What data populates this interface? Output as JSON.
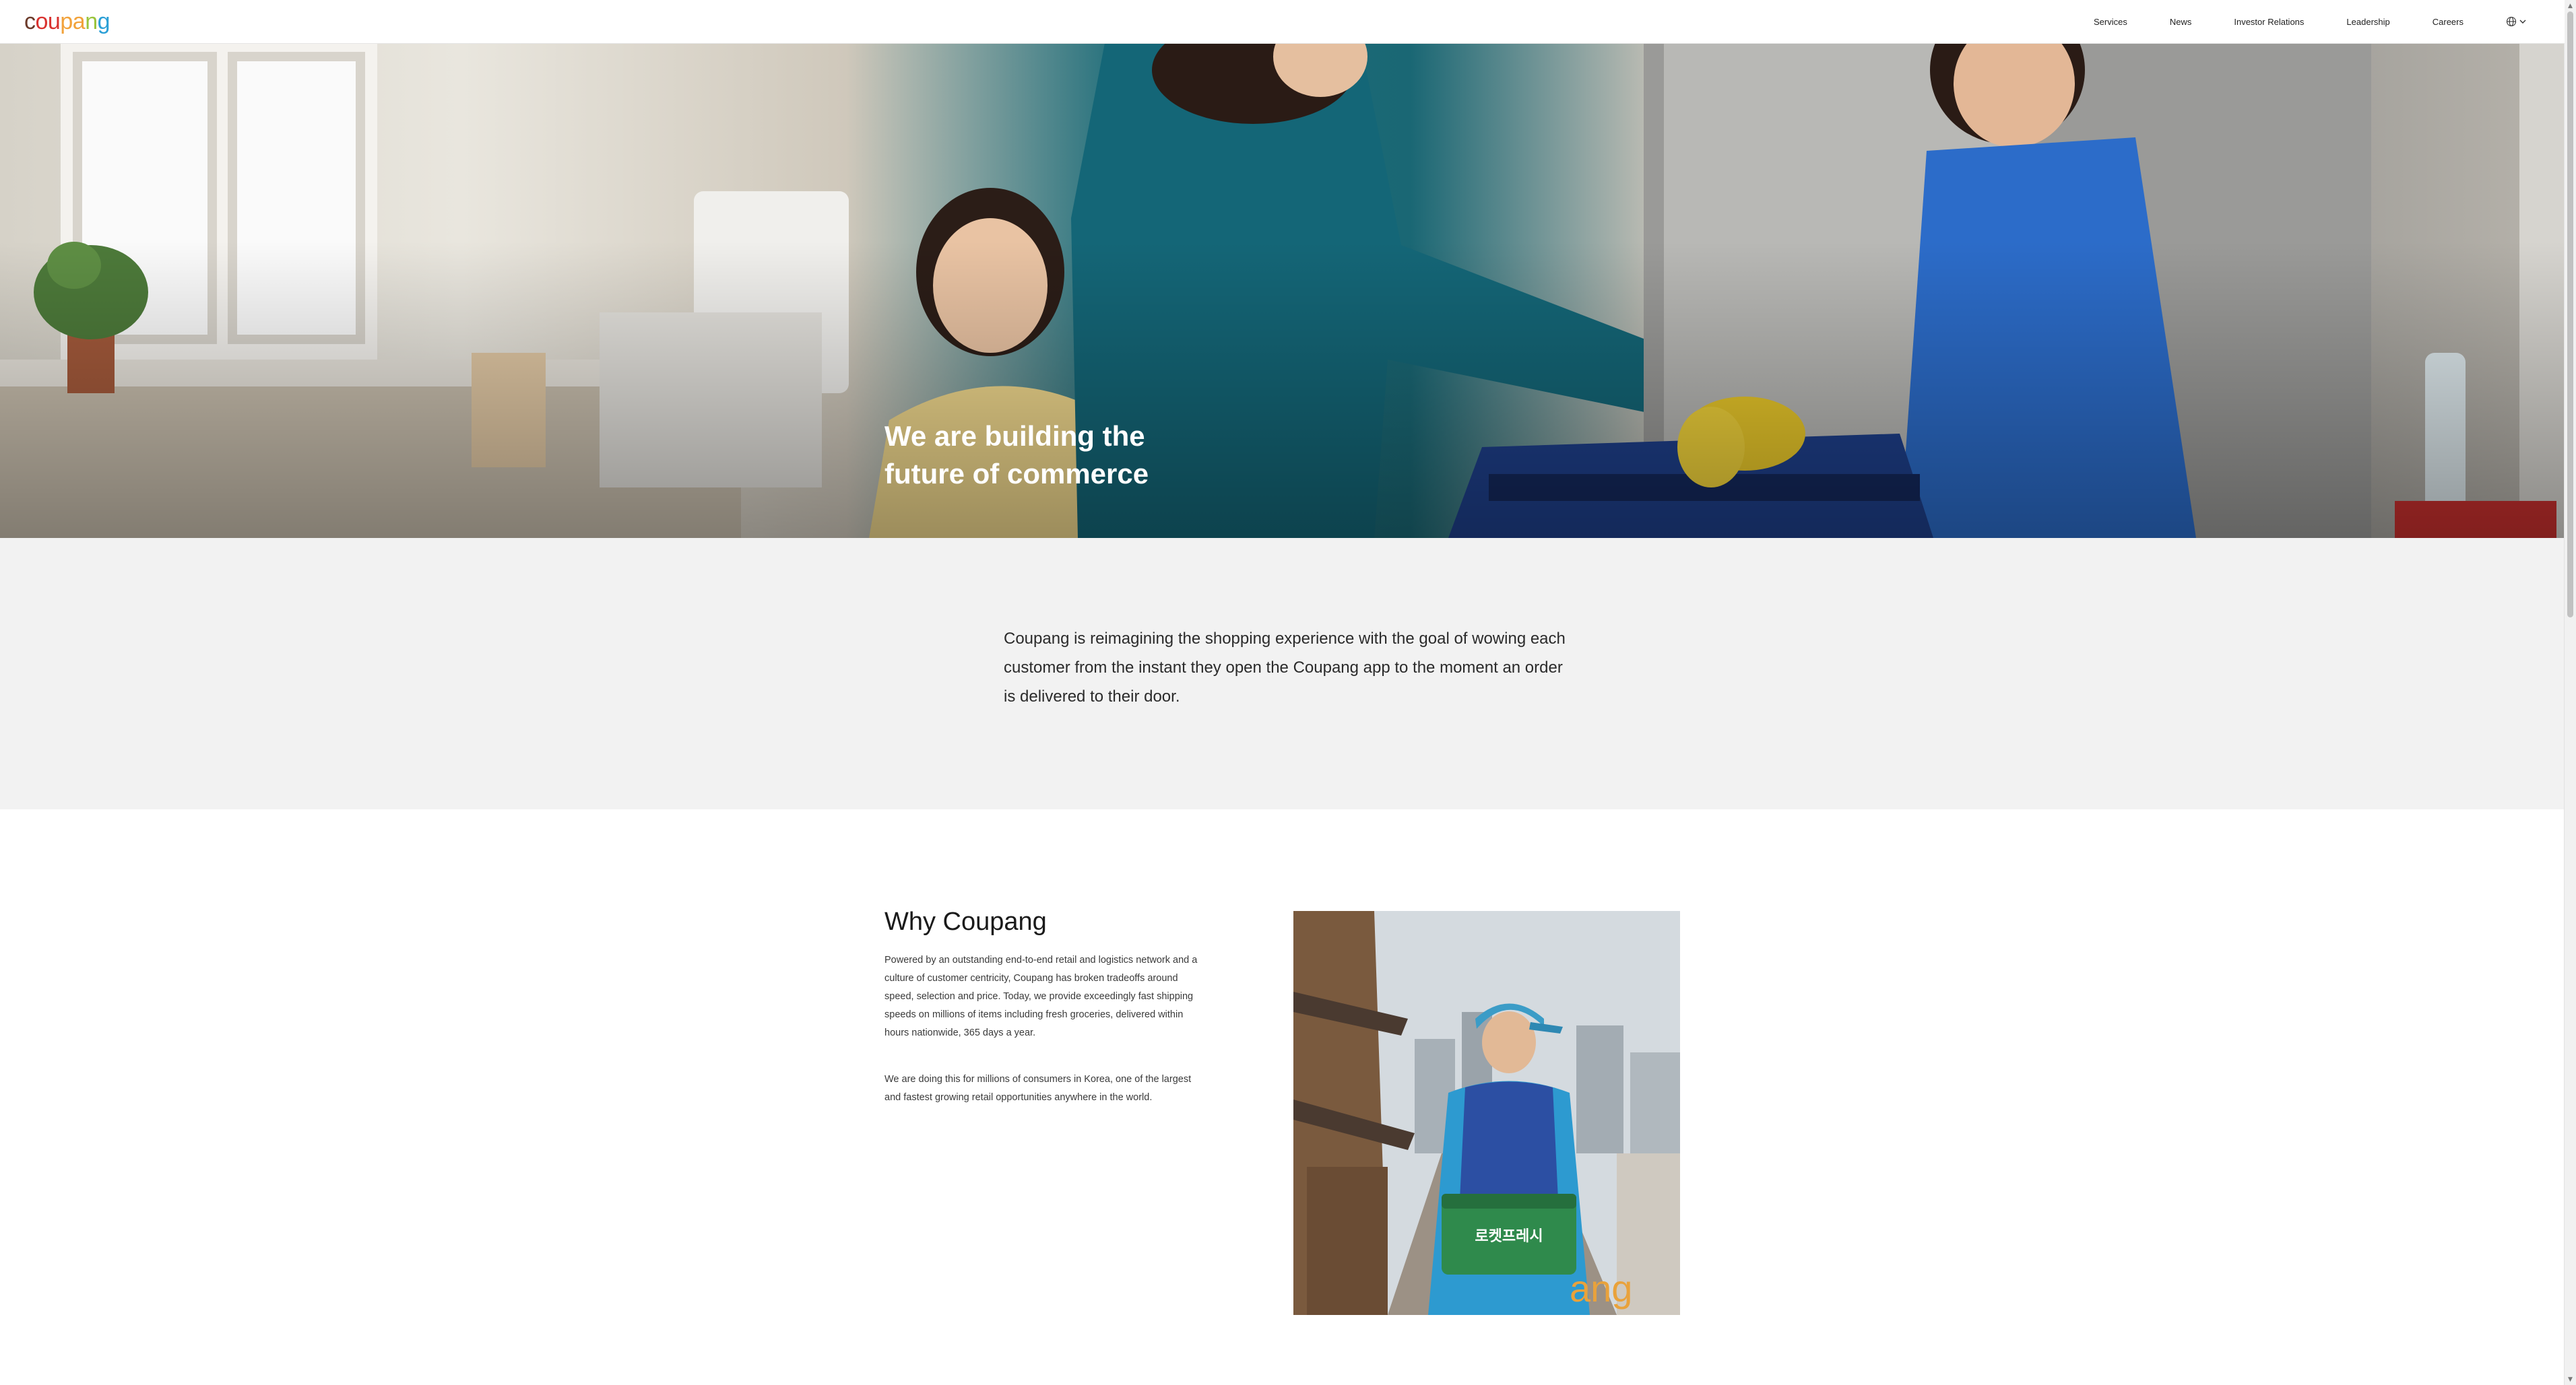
{
  "brand": {
    "logo_text": "coupang",
    "logo_letters": [
      {
        "ch": "c",
        "color": "#6b3a2a"
      },
      {
        "ch": "o",
        "color": "#d9322f"
      },
      {
        "ch": "u",
        "color": "#d9322f"
      },
      {
        "ch": "p",
        "color": "#f2a23a"
      },
      {
        "ch": "a",
        "color": "#f2a23a"
      },
      {
        "ch": "n",
        "color": "#9ac43b"
      },
      {
        "ch": "g",
        "color": "#2a9fd6"
      }
    ]
  },
  "nav": {
    "items": [
      "Services",
      "News",
      "Investor Relations",
      "Leadership",
      "Careers"
    ],
    "language_icon": "globe-icon",
    "language_chevron": "chevron-down-icon"
  },
  "hero": {
    "title_line1": "We are building the",
    "title_line2": "future of commerce"
  },
  "intro": {
    "text": "Coupang is reimagining the shopping experience with the goal of wowing each customer from the instant they open the Coupang app to the moment an order is delivered to their door."
  },
  "why": {
    "title": "Why Coupang",
    "paragraph1": "Powered by an outstanding end-to-end retail and logistics network and a culture of customer centricity, Coupang has broken tradeoffs around speed, selection and price. Today, we provide exceedingly fast shipping speeds on millions of items including fresh groceries, delivered within hours nationwide, 365 days a year.",
    "paragraph2": "We are doing this for millions of consumers in Korea, one of the largest and fastest growing retail opportunities anywhere in the world.",
    "photo_box_text": "로켓프레시",
    "photo_sign_text": "ang"
  },
  "colors": {
    "intro_bg": "#f2f2f2",
    "hero_teal": "#1a6774",
    "delivery_blue": "#2c4fa3"
  }
}
